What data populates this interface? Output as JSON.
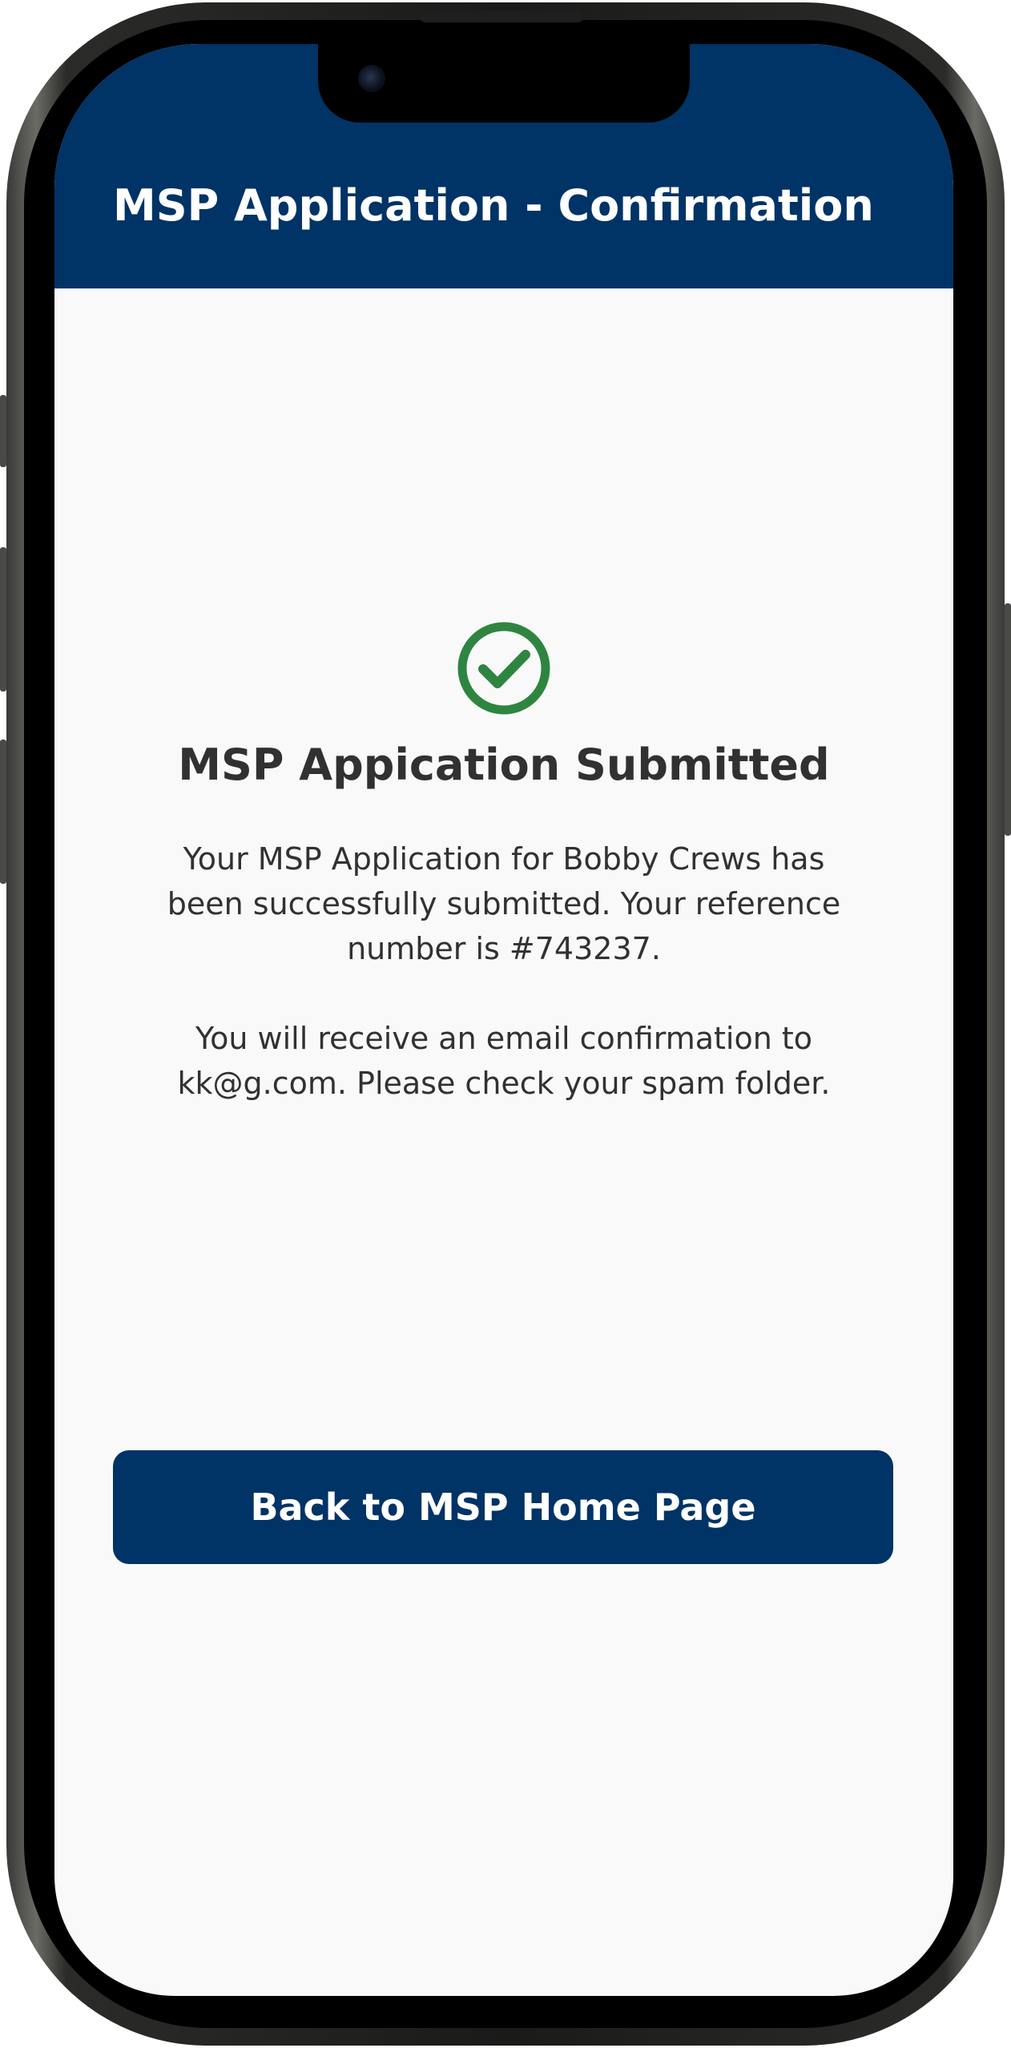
{
  "header": {
    "title": "MSP Application - Confirmation"
  },
  "confirmation": {
    "icon": "check-circle-icon",
    "heading": "MSP Appication Submitted",
    "message_line_1": "Your MSP Application for Bobby Crews has been successfully submitted. Your reference number is #743237.",
    "message_line_2": "You will receive an email confirmation to kk@g.com. Please check your spam folder."
  },
  "actions": {
    "home_button_label": "Back to MSP Home Page"
  },
  "colors": {
    "brand_navy": "#003366",
    "success_green": "#2e8540",
    "text_dark": "#313132",
    "page_background": "#f9f9f9"
  }
}
